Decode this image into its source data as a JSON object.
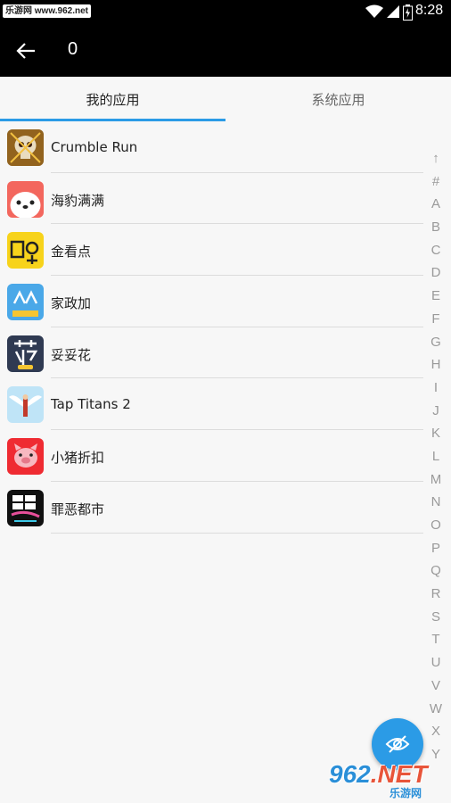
{
  "status_bar": {
    "watermark": "乐游网 www.962.net",
    "time": "8:28"
  },
  "toolbar": {
    "title": "0"
  },
  "tabs": [
    {
      "label": "我的应用",
      "active": true
    },
    {
      "label": "系统应用",
      "active": false
    }
  ],
  "apps": [
    {
      "name": "Crumble Run",
      "icon": "skull-game-icon"
    },
    {
      "name": "海豹满满",
      "icon": "seal-face-icon"
    },
    {
      "name": "金看点",
      "icon": "yellow-news-icon"
    },
    {
      "name": "家政加",
      "icon": "housekeeping-icon"
    },
    {
      "name": "妥妥花",
      "icon": "flower-loan-icon"
    },
    {
      "name": "Tap Titans 2",
      "icon": "winged-hero-icon"
    },
    {
      "name": "小猪折扣",
      "icon": "pig-icon"
    },
    {
      "name": "罪恶都市",
      "icon": "gta-vice-city-icon"
    }
  ],
  "index_bar": [
    "↑",
    "#",
    "A",
    "B",
    "C",
    "D",
    "E",
    "F",
    "G",
    "H",
    "I",
    "J",
    "K",
    "L",
    "M",
    "N",
    "O",
    "P",
    "Q",
    "R",
    "S",
    "T",
    "U",
    "V",
    "W",
    "X",
    "Y"
  ],
  "fab": {
    "icon": "eye-off-icon"
  },
  "corner_logo": {
    "number": "962",
    "suffix": ".NET",
    "subtitle": "乐游网"
  },
  "colors": {
    "accent": "#2b9be6",
    "toolbar": "#000000"
  }
}
